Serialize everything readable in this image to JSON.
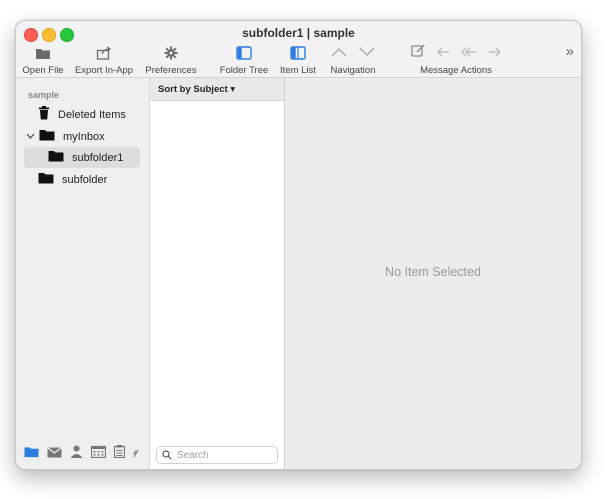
{
  "window": {
    "title": "subfolder1 | sample"
  },
  "toolbar": {
    "open_file": "Open File",
    "export_in_app": "Export In-App",
    "preferences": "Preferences",
    "folder_tree": "Folder Tree",
    "item_list": "Item List",
    "navigation": "Navigation",
    "message_actions": "Message Actions"
  },
  "sidebar": {
    "account": "sample",
    "items": [
      {
        "label": "Deleted Items",
        "icon": "trash-icon"
      },
      {
        "label": "myInbox",
        "icon": "folder-icon"
      },
      {
        "label": "subfolder1",
        "icon": "folder-icon"
      },
      {
        "label": "subfolder",
        "icon": "folder-icon"
      }
    ],
    "bottom_icons": [
      "folder-icon",
      "mail-icon",
      "person-icon",
      "calendar-icon",
      "notes-icon",
      "link-icon"
    ]
  },
  "list": {
    "sort_label": "Sort by Subject ▾",
    "search_placeholder": "Search"
  },
  "reading": {
    "empty_text": "No Item Selected"
  },
  "colors": {
    "accent": "#2a7de1",
    "pane": "#ececec",
    "sidebar": "#efefef"
  }
}
